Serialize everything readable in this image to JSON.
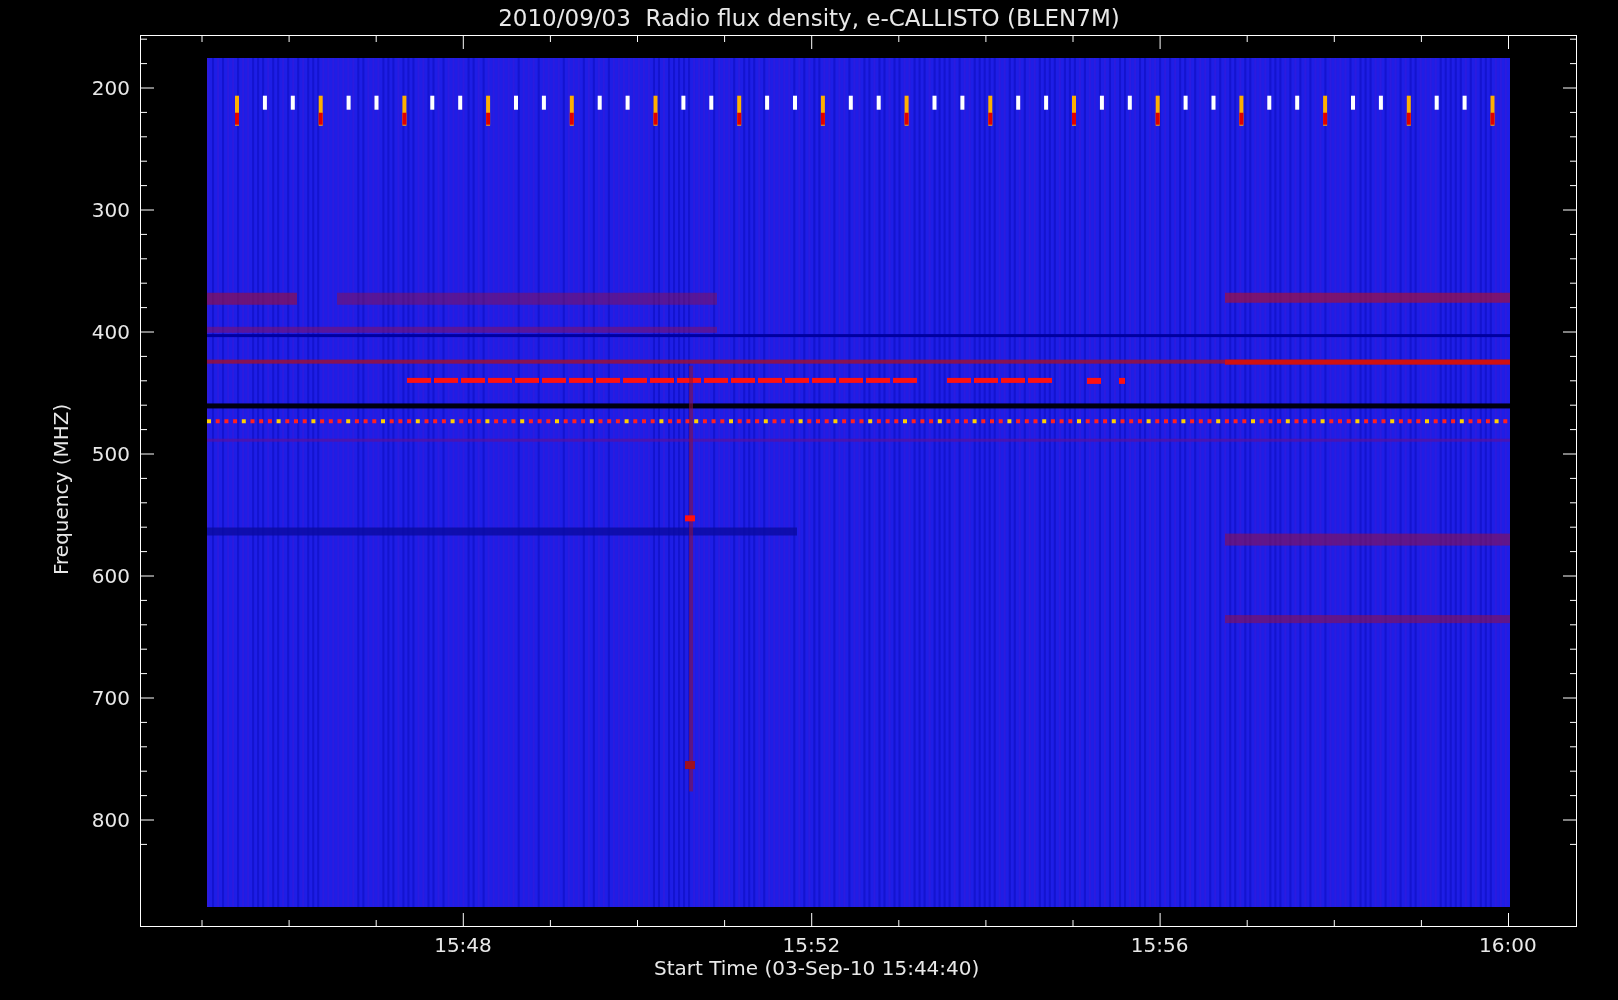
{
  "title": "2010/09/03  Radio flux density, e-CALLISTO (BLEN7M)",
  "y_axis": {
    "label": "Frequency (MHZ)",
    "ticks": [
      "200",
      "300",
      "400",
      "500",
      "600",
      "700",
      "800"
    ]
  },
  "x_axis": {
    "label": "Start Time (03-Sep-10 15:44:40)",
    "ticks": [
      "15:48",
      "15:52",
      "15:56",
      "16:00"
    ]
  }
}
